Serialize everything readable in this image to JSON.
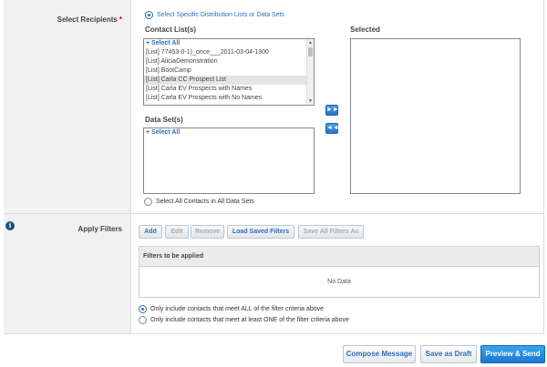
{
  "recipients": {
    "label": "Select Recipients",
    "required_mark": "*",
    "option_specific": "Select Specific Distribution Lists or Data Sets",
    "contact_lists_label": "Contact List(s)",
    "contact_lists": [
      "+ Select All",
      "[List] 77453-0-1)_once___2011-03-04-1300",
      "[List] AliciaDemonstration",
      "[List] BootCamp",
      "[List] Carla CC Prospect List",
      "[List] Carla EV Prospects with Names",
      "[List] Carla EV Prospects with No Names"
    ],
    "contact_lists_selected_index": 4,
    "selected_label": "Selected",
    "data_sets_label": "Data Set(s)",
    "data_sets": [
      "+ Select All"
    ],
    "option_all": "Select All Contacts in All Data Sets"
  },
  "filters": {
    "label": "Apply Filters",
    "info_icon": "i",
    "buttons": {
      "add": "Add",
      "edit": "Edit",
      "remove": "Remove",
      "load_saved": "Load Saved Filters",
      "save_all": "Save All Filters As"
    },
    "table_header": "Filters to be applied",
    "empty_text": "No Data",
    "match_all": "Only include contacts that meet ALL of the filter criteria above",
    "match_any": "Only include contacts that meet at least ONE of the filter criteria above"
  },
  "actions": {
    "compose": "Compose Message",
    "save_draft": "Save as Draft",
    "preview_send": "Preview & Send"
  },
  "icons": {
    "move_right": "►►",
    "move_left": "◄◄",
    "info": "info-icon"
  },
  "colors": {
    "accent": "#2a6ebb",
    "primary_button": "#1a78cf",
    "required": "#cc0000",
    "info_icon": "#1f4e79"
  }
}
